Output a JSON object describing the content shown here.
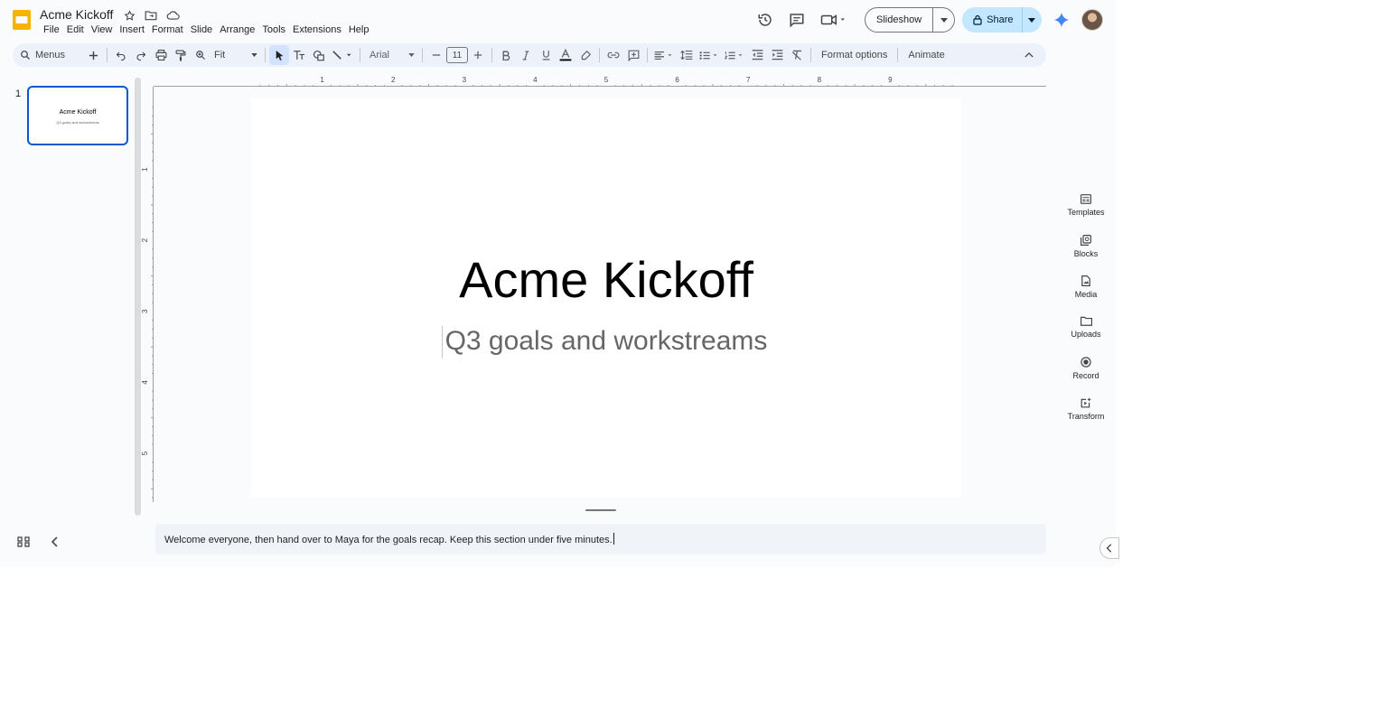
{
  "app": {
    "title": "Acme Kickoff",
    "menu": [
      "File",
      "Edit",
      "View",
      "Insert",
      "Format",
      "Slide",
      "Arrange",
      "Tools",
      "Extensions",
      "Help"
    ]
  },
  "header": {
    "slideshow_label": "Slideshow",
    "share_label": "Share"
  },
  "toolbar": {
    "search_label": "Menus",
    "zoom_value": "Fit",
    "font_value": "Arial",
    "font_size": "11",
    "format_options_label": "Format options",
    "animate_label": "Animate"
  },
  "filmstrip": {
    "slides": [
      {
        "number": "1",
        "title": "Acme Kickoff",
        "subtitle": "Q3 goals and workstreams"
      }
    ]
  },
  "rulers": {
    "top_ticks": [
      "1",
      "2",
      "3",
      "4",
      "5",
      "6",
      "7",
      "8",
      "9"
    ],
    "left_ticks": [
      "1",
      "2",
      "3",
      "4",
      "5"
    ]
  },
  "slide": {
    "title": "Acme Kickoff",
    "subtitle": "Q3 goals and workstreams"
  },
  "notes": {
    "text": "Welcome everyone, then hand over to Maya for the goals recap. Keep this section under five minutes."
  },
  "side_panel": {
    "items": [
      {
        "label": "Templates",
        "icon": "templates-icon"
      },
      {
        "label": "Blocks",
        "icon": "blocks-icon"
      },
      {
        "label": "Media",
        "icon": "media-icon"
      },
      {
        "label": "Uploads",
        "icon": "uploads-icon"
      },
      {
        "label": "Record",
        "icon": "record-icon"
      },
      {
        "label": "Transform",
        "icon": "transform-icon"
      }
    ]
  },
  "colors": {
    "accent": "#0b57d0",
    "share_bg": "#c2e7ff",
    "toolbar_bg": "#edf2fa",
    "app_bg": "#f9fbfd",
    "logo_yellow": "#f4b400"
  }
}
